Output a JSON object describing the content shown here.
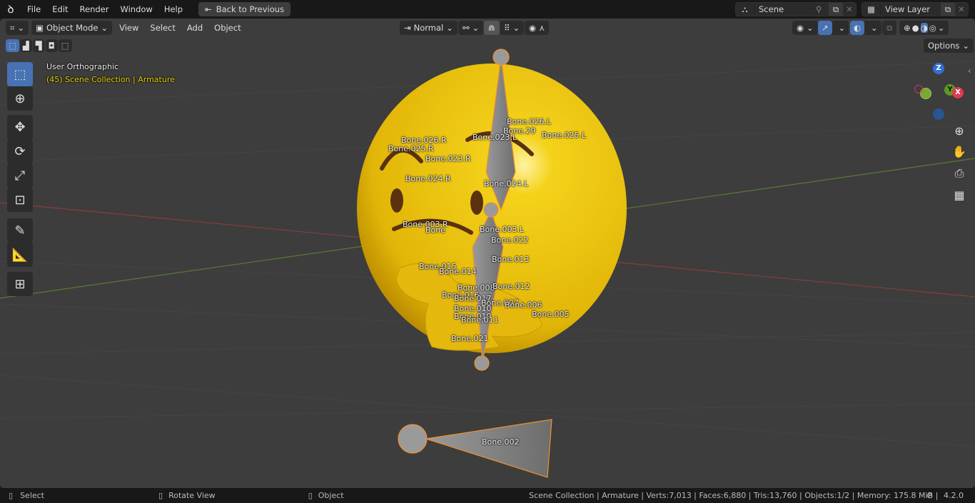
{
  "topbar": {
    "menus": [
      "File",
      "Edit",
      "Render",
      "Window",
      "Help"
    ],
    "back_button": "Back to Previous",
    "scene": "Scene",
    "view_layer": "View Layer"
  },
  "header": {
    "mode": "Object Mode",
    "menus": [
      "View",
      "Select",
      "Add",
      "Object"
    ],
    "orientation": "Normal",
    "options": "Options"
  },
  "overlay": {
    "view_name": "User Orthographic",
    "collection_info": "(45) Scene Collection | Armature"
  },
  "gizmo": {
    "z": "Z",
    "y": "Y",
    "x": "X"
  },
  "bones": [
    "Bone.026.L",
    "Bone.29",
    "Bone.025.L",
    "Bone.023.L",
    "Bone.026.R",
    "Bone.025.R",
    "Bone.023.R",
    "Bone.024.R",
    "Bone.024.L",
    "Bone.003.R",
    "Bone",
    "Bone.003.L",
    "Bone.022",
    "Bone.013",
    "Bone.015",
    "Bone.014",
    "Bone.008",
    "Bone.012",
    "Bone.016",
    "Bone.017",
    "Bone.007",
    "Bone.006",
    "Bone.005",
    "Bone.010",
    "Bone.019",
    "Bone.011",
    "Bone.021",
    "Bone.002"
  ],
  "status": {
    "select": "Select",
    "rotate": "Rotate View",
    "object": "Object",
    "stats": "Scene Collection | Armature | Verts:7,013 | Faces:6,880 | Tris:13,760 | Objects:1/2 | Memory: 175.8 MiB |",
    "version": "4.2.0"
  },
  "colors": {
    "accent": "#4772b3",
    "selection": "#f0922c",
    "sphere": "#e8c012",
    "text_yellow": "#e6d200"
  }
}
